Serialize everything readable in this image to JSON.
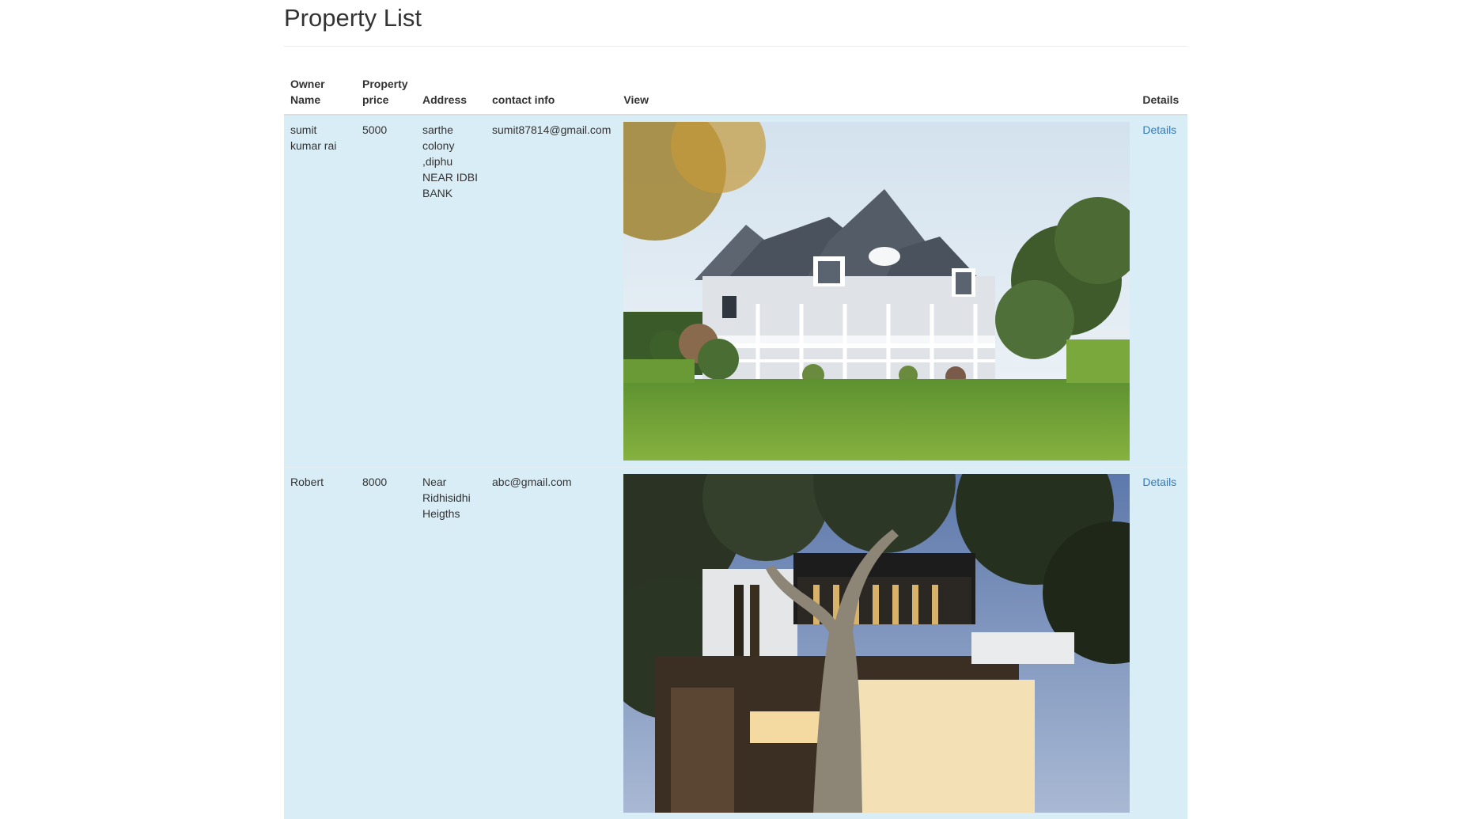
{
  "page": {
    "title": "Property List"
  },
  "table": {
    "headers": {
      "owner": "Owner Name",
      "price": "Property price",
      "address": "Address",
      "contact": "contact info",
      "view": "View",
      "details": "Details"
    },
    "rows": [
      {
        "owner": "sumit kumar rai",
        "price": "5000",
        "address": "sarthe colony ,diphu NEAR IDBI BANK",
        "contact": "sumit87814@gmail.com",
        "details_link": "Details"
      },
      {
        "owner": "Robert",
        "price": "8000",
        "address": "Near Ridhisidhi Heigths",
        "contact": "abc@gmail.com",
        "details_link": "Details"
      }
    ]
  }
}
